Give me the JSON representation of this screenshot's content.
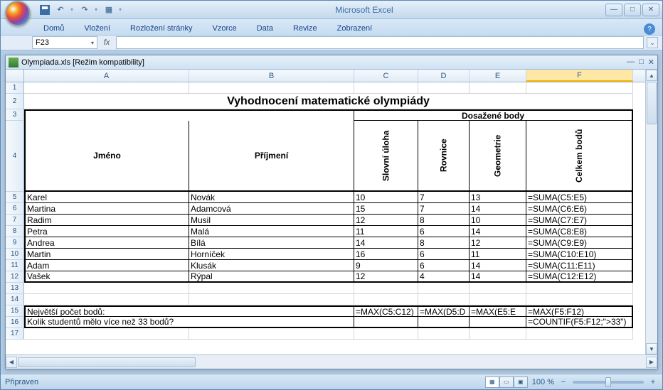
{
  "app": {
    "title": "Microsoft Excel"
  },
  "ribbon": {
    "tabs": [
      "Domů",
      "Vložení",
      "Rozložení stránky",
      "Vzorce",
      "Data",
      "Revize",
      "Zobrazení"
    ]
  },
  "namebox": {
    "value": "F23"
  },
  "fx": "fx",
  "workbook": {
    "title": "Olympiada.xls  [Režim kompatibility]"
  },
  "columns": [
    "A",
    "B",
    "C",
    "D",
    "E",
    "F"
  ],
  "title_row": "Vyhodnocení matematické olympiády",
  "headers": {
    "merged": "Dosažené body",
    "jmeno": "Jméno",
    "prijmeni": "Příjmení",
    "slovni": "Slovní úloha",
    "rovnice": "Rovnice",
    "geometrie": "Geometrie",
    "celkem": "Celkem bodů"
  },
  "rows": [
    {
      "n": "5",
      "a": "Karel",
      "b": "Novák",
      "c": "10",
      "d": "7",
      "e": "13",
      "f": "=SUMA(C5:E5)"
    },
    {
      "n": "6",
      "a": "Martina",
      "b": "Adamcová",
      "c": "15",
      "d": "7",
      "e": "14",
      "f": "=SUMA(C6:E6)"
    },
    {
      "n": "7",
      "a": "Radim",
      "b": "Musil",
      "c": "12",
      "d": "8",
      "e": "10",
      "f": "=SUMA(C7:E7)"
    },
    {
      "n": "8",
      "a": "Petra",
      "b": "Malá",
      "c": "11",
      "d": "6",
      "e": "14",
      "f": "=SUMA(C8:E8)"
    },
    {
      "n": "9",
      "a": "Andrea",
      "b": "Bílá",
      "c": "14",
      "d": "8",
      "e": "12",
      "f": "=SUMA(C9:E9)"
    },
    {
      "n": "10",
      "a": "Martin",
      "b": "Horníček",
      "c": "16",
      "d": "6",
      "e": "11",
      "f": "=SUMA(C10:E10)"
    },
    {
      "n": "11",
      "a": "Adam",
      "b": "Klusák",
      "c": "9",
      "d": "6",
      "e": "14",
      "f": "=SUMA(C11:E11)"
    },
    {
      "n": "12",
      "a": "Vašek",
      "b": "Rýpal",
      "c": "12",
      "d": "4",
      "e": "14",
      "f": "=SUMA(C12:E12)"
    }
  ],
  "row15": {
    "n": "15",
    "a": "Největší počet bodů:",
    "c": "=MAX(C5:C12)",
    "d": "=MAX(D5:D",
    "e": "=MAX(E5:E",
    "f": "=MAX(F5:F12)"
  },
  "row16": {
    "n": "16",
    "a": "Kolik studentů mělo více než 33 bodů?",
    "f": "=COUNTIF(F5:F12;\">33\")"
  },
  "status": {
    "ready": "Připraven",
    "zoom": "100 %"
  },
  "chart_data": {
    "type": "table",
    "title": "Vyhodnocení matematické olympiády",
    "columns": [
      "Jméno",
      "Příjmení",
      "Slovní úloha",
      "Rovnice",
      "Geometrie",
      "Celkem bodů"
    ],
    "data": [
      [
        "Karel",
        "Novák",
        10,
        7,
        13,
        "=SUMA(C5:E5)"
      ],
      [
        "Martina",
        "Adamcová",
        15,
        7,
        14,
        "=SUMA(C6:E6)"
      ],
      [
        "Radim",
        "Musil",
        12,
        8,
        10,
        "=SUMA(C7:E7)"
      ],
      [
        "Petra",
        "Malá",
        11,
        6,
        14,
        "=SUMA(C8:E8)"
      ],
      [
        "Andrea",
        "Bílá",
        14,
        8,
        12,
        "=SUMA(C9:E9)"
      ],
      [
        "Martin",
        "Horníček",
        16,
        6,
        11,
        "=SUMA(C10:E10)"
      ],
      [
        "Adam",
        "Klusák",
        9,
        6,
        14,
        "=SUMA(C11:E11)"
      ],
      [
        "Vašek",
        "Rýpal",
        12,
        4,
        14,
        "=SUMA(C12:E12)"
      ]
    ]
  }
}
